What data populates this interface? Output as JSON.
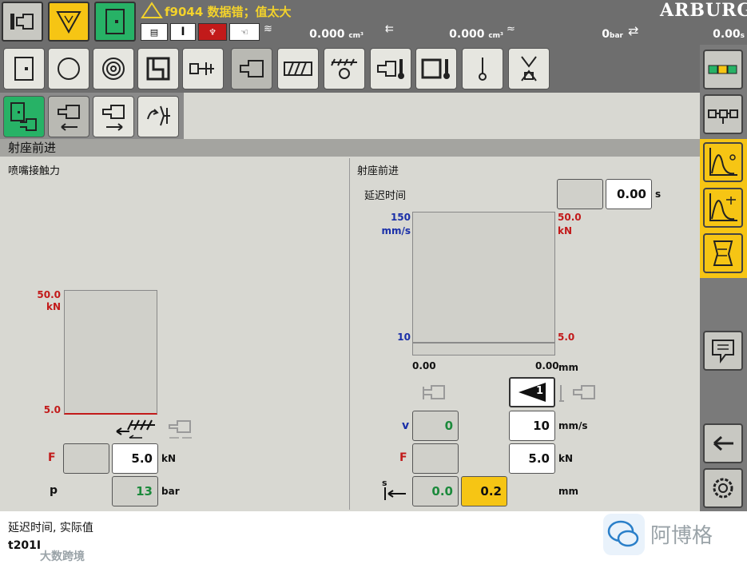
{
  "topbar": {
    "alarm_text": "f9044 数据错；值太大",
    "brand": "ARBURG",
    "readout1": {
      "value": "0.000",
      "unit": "cm³"
    },
    "readout2": {
      "value": "0.000",
      "unit": "cm³"
    },
    "readout3": {
      "value": "0",
      "unit": "bar"
    },
    "readout4": {
      "value": "0.00",
      "unit": "s"
    },
    "mini_btn_I": "I"
  },
  "header": {
    "title": "射座前进"
  },
  "left_panel": {
    "title": "喷嘴接触力",
    "chart": {
      "y_top": "50.0",
      "y_top_unit": "kN",
      "y_bottom": "5.0"
    },
    "F_label": "F",
    "F_value": "5.0",
    "F_unit": "kN",
    "p_label": "p",
    "p_value": "13",
    "p_unit": "bar"
  },
  "right_panel": {
    "title": "射座前进",
    "delay_label": "延迟时间",
    "delay_value": "0.00",
    "delay_unit": "s",
    "chart": {
      "left_top": "150",
      "left_top_unit": "mm/s",
      "left_bottom": "10",
      "right_top": "50.0",
      "right_top_unit": "kN",
      "right_bottom": "5.0",
      "x_left": "0.00",
      "x_right": "0.00",
      "x_unit": "mm"
    },
    "stage_number": "1",
    "v_label": "v",
    "v_actual": "0",
    "v_set": "10",
    "v_unit": "mm/s",
    "F_label": "F",
    "F_set": "5.0",
    "F_unit": "kN",
    "s_label": "s",
    "s_actual": "0.0",
    "s_set": "0.2",
    "s_unit": "mm"
  },
  "footer": {
    "line1": "延迟时间, 实际值",
    "line2": "t201I",
    "watermark_left": "大数跨境",
    "watermark_right": "阿博格"
  },
  "colors": {
    "yellow": "#f6c514",
    "green": "#27b266",
    "red": "#c21a1a",
    "blue": "#1a2fa8"
  }
}
